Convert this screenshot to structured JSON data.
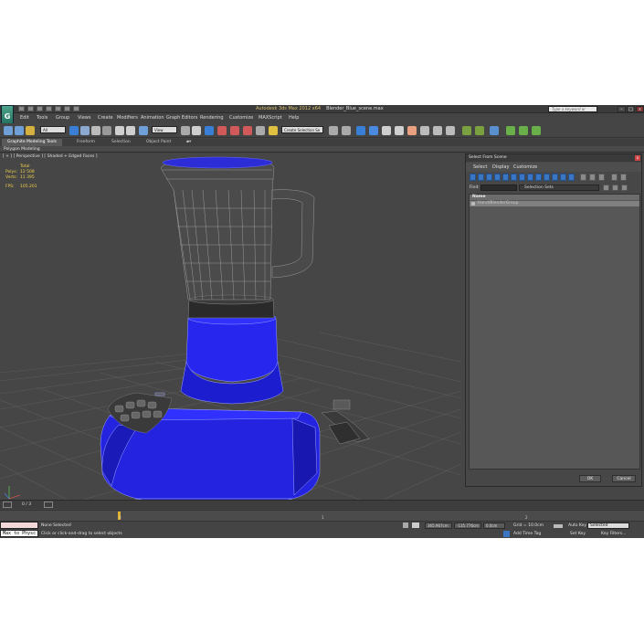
{
  "app": {
    "title": "Autodesk 3ds Max  2012 x64",
    "file": "Blender_Blue_scene.max",
    "logo_letter": "G",
    "search_placeholder": "Type a keyword or phrase"
  },
  "menu": [
    "Edit",
    "Tools",
    "Group",
    "Views",
    "Create",
    "Modifiers",
    "Animation",
    "Graph Editors",
    "Rendering",
    "Customize",
    "MAXScript",
    "Help"
  ],
  "toolbar": {
    "filter_value": "All",
    "view_value": "View",
    "selection_set_value": "Create Selection Se"
  },
  "ribbon": {
    "tabs": [
      "Graphite Modeling Tools",
      "Freeform",
      "Selection",
      "Object Paint"
    ],
    "active_sub": "Polygon Modeling"
  },
  "viewport": {
    "label": "[ + ] [ Perspective ] [ Shaded + Edged Faces ]",
    "stats": [
      {
        "k": "",
        "v": "Total"
      },
      {
        "k": "Polys:",
        "v": "12 508"
      },
      {
        "k": "Verts:",
        "v": "11 395"
      }
    ],
    "fps_label": "FPS:",
    "fps_value": "105.201",
    "model_color": "#2222e6"
  },
  "dialog": {
    "title": "Select From Scene",
    "close": "x",
    "menu": [
      "Select",
      "Display",
      "Customize"
    ],
    "find_label": "Find:",
    "selection_sets": "Selection Sets",
    "column_name": "Name",
    "items": [
      "Hand/BlenderGroup"
    ],
    "ok": "OK",
    "cancel": "Cancel"
  },
  "timeline": {
    "frame": "0 / 3",
    "ticks": [
      "0",
      "1",
      "2"
    ]
  },
  "status": {
    "maxscript_text": "Max to Physc",
    "none_selected": "None Selected",
    "prompt": "Click or click-and-drag to select objects",
    "x": "365.967cm",
    "y": "-135.776cm",
    "z": "0.0cm",
    "grid": "Grid = 10.0cm",
    "auto_key": "Auto Key",
    "selected": "Selected",
    "set_key": "Set Key",
    "key_filters": "Key Filters...",
    "add_time_tag": "Add Time Tag"
  }
}
